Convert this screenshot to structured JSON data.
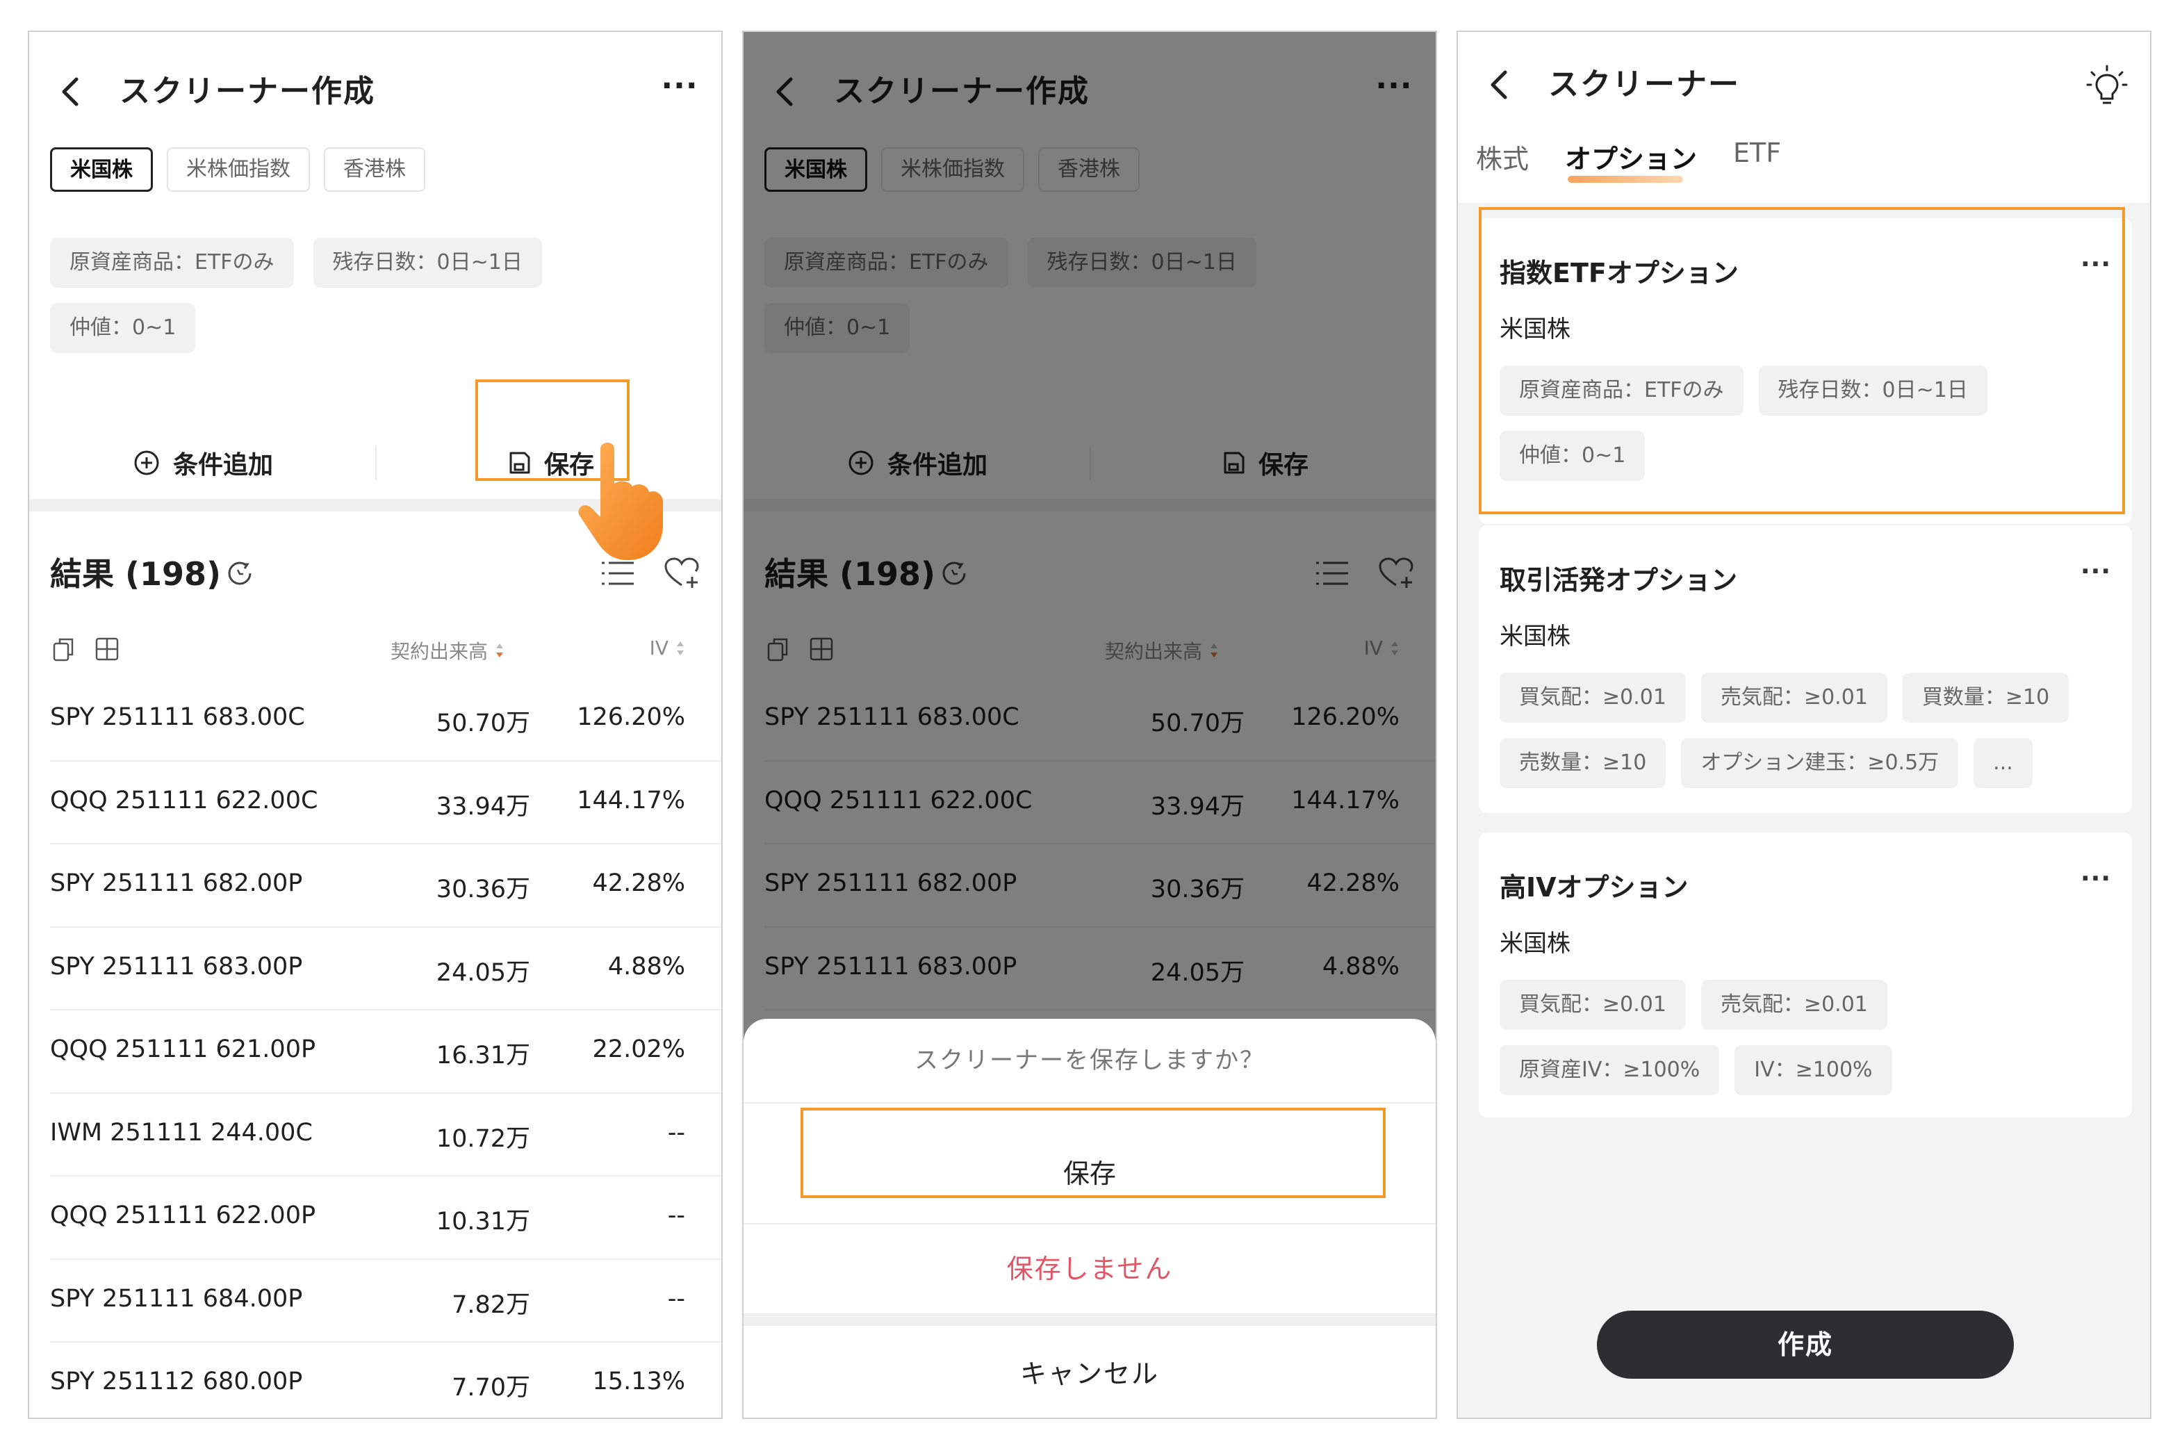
{
  "screener_edit": {
    "title": "スクリーナー作成",
    "more_label": "···",
    "market_tabs": [
      {
        "label": "米国株",
        "active": true
      },
      {
        "label": "米株価指数",
        "active": false
      },
      {
        "label": "香港株",
        "active": false
      }
    ],
    "conditions": [
      "原資産商品：ETFのみ",
      "残存日数：0日~1日",
      "仲値：0~1"
    ],
    "add_condition_label": "条件追加",
    "save_label": "保存",
    "results_label": "結果 (198)",
    "columns": {
      "volume": "契約出来高",
      "iv": "IV"
    },
    "rows": [
      {
        "name": "SPY 251111 683.00C",
        "volume": "50.70万",
        "iv": "126.20%"
      },
      {
        "name": "QQQ 251111 622.00C",
        "volume": "33.94万",
        "iv": "144.17%"
      },
      {
        "name": "SPY 251111 682.00P",
        "volume": "30.36万",
        "iv": "42.28%"
      },
      {
        "name": "SPY 251111 683.00P",
        "volume": "24.05万",
        "iv": "4.88%"
      },
      {
        "name": "QQQ 251111 621.00P",
        "volume": "16.31万",
        "iv": "22.02%"
      },
      {
        "name": "IWM 251111 244.00C",
        "volume": "10.72万",
        "iv": "--"
      },
      {
        "name": "QQQ 251111 622.00P",
        "volume": "10.31万",
        "iv": "--"
      },
      {
        "name": "SPY 251111 684.00P",
        "volume": "7.82万",
        "iv": "--"
      },
      {
        "name": "SPY 251112 680.00P",
        "volume": "7.70万",
        "iv": "15.13%"
      }
    ]
  },
  "save_dialog": {
    "question": "スクリーナーを保存しますか？",
    "save": "保存",
    "dont_save": "保存しません",
    "cancel": "キャンセル"
  },
  "screener_list": {
    "title": "スクリーナー",
    "tabs": [
      {
        "label": "株式",
        "active": false
      },
      {
        "label": "オプション",
        "active": true
      },
      {
        "label": "ETF",
        "active": false
      }
    ],
    "cards": [
      {
        "title": "指数ETFオプション",
        "market": "米国株",
        "chips": [
          "原資産商品：ETFのみ",
          "残存日数：0日~1日",
          "仲値：0~1"
        ]
      },
      {
        "title": "取引活発オプション",
        "market": "米国株",
        "chips": [
          "買気配：≥0.01",
          "売気配：≥0.01",
          "買数量：≥10",
          "売数量：≥10",
          "オプション建玉：≥0.5万",
          "..."
        ]
      },
      {
        "title": "高IVオプション",
        "market": "米国株",
        "chips": [
          "買気配：≥0.01",
          "売気配：≥0.01",
          "原資産IV：≥100%",
          "IV：≥100%"
        ]
      }
    ],
    "create_label": "作成"
  },
  "colors": {
    "highlight": "#f59a2a",
    "accent_orange": "#f7a35b",
    "danger": "#e05666",
    "dark_button": "#2d2e30"
  }
}
